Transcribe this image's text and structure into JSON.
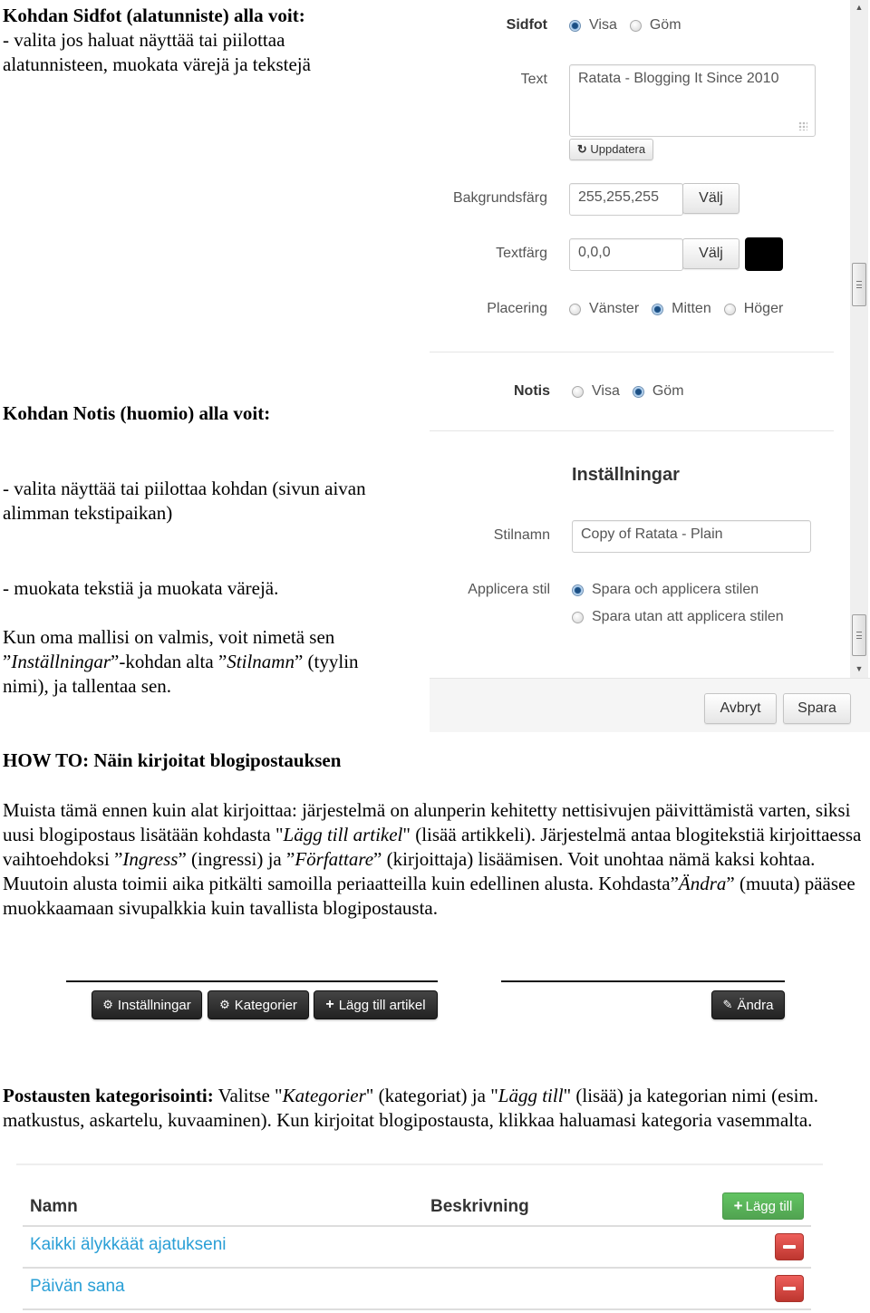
{
  "doc": {
    "sidfot_heading": "Kohdan Sidfot (alatunniste) alla voit:",
    "sidfot_line1": "- valita jos haluat näyttää tai piilottaa",
    "sidfot_line2": "alatunnisteen, muokata värejä ja tekstejä",
    "notis_heading": "Kohdan Notis (huomio) alla voit:",
    "notis_bullet1_line1": "- valita näyttää tai piilottaa kohdan (sivun aivan",
    "notis_bullet1_line2": "alimman tekstipaikan)",
    "notis_bullet2": "- muokata tekstiä ja muokata värejä.",
    "save_p_line1": "Kun oma mallisi on valmis, voit nimetä sen",
    "save_p_line2_q1": "”",
    "save_p_line2_em1": "Inställningar",
    "save_p_line2_mid": "”-kohdan alta ”",
    "save_p_line2_em2": "Stilnamn",
    "save_p_line2_end": "” (tyylin",
    "save_p_line3": "nimi), ja tallentaa sen.",
    "howto_heading": "HOW TO: Näin kirjoitat blogipostauksen",
    "howto_p": {
      "t1": "Muista tämä ennen kuin alat kirjoittaa: järjestelmä on alunperin kehitetty nettisivujen päivittämistä varten, siksi uusi blogipostaus lisätään kohdasta \"",
      "em1": "Lägg till artikel",
      "t2": "\" (lisää artikkeli). Järjestelmä antaa blogitekstiä kirjoittaessa vaihtoehdoksi ”",
      "em2": "Ingress",
      "t3": "” (ingressi) ja ”",
      "em3": "Författare",
      "t4": "” (kirjoittaja) lisäämisen. Voit unohtaa nämä kaksi kohtaa. Muutoin alusta toimii aika pitkälti samoilla periaatteilla kuin edellinen alusta. Kohdasta”",
      "em4": "Ändra",
      "t5": "” (muuta) pääsee muokkaamaan sivupalkkia kuin tavallista blogipostausta."
    },
    "cat_p": {
      "bold": "Postausten kategorisointi:",
      "t1": " Valitse \"",
      "em1": "Kategorier",
      "t2": "\" (kategoriat) ja \"",
      "em2": "Lägg till",
      "t3": "\" (lisää) ja kategorian nimi (esim. matkustus, askartelu, kuvaaminen). Kun kirjoitat blogipostausta, klikkaa haluamasi kategoria vasemmalta."
    }
  },
  "panel": {
    "sidfot": {
      "label": "Sidfot",
      "options": [
        "Visa",
        "Göm"
      ],
      "selected": "Visa"
    },
    "text": {
      "label": "Text",
      "value": "Ratata - Blogging It Since 2010",
      "update_button": "Uppdatera",
      "update_icon": "refresh-icon"
    },
    "bakgrundsfarg": {
      "label": "Bakgrundsfärg",
      "value": "255,255,255",
      "button": "Välj"
    },
    "textfarg": {
      "label": "Textfärg",
      "value": "0,0,0",
      "button": "Välj",
      "swatch_color": "#000000"
    },
    "placering": {
      "label": "Placering",
      "options": [
        "Vänster",
        "Mitten",
        "Höger"
      ],
      "selected": "Mitten"
    },
    "notis": {
      "label": "Notis",
      "options": [
        "Visa",
        "Göm"
      ],
      "selected": "Göm"
    },
    "installningar_heading": "Inställningar",
    "stilnamn": {
      "label": "Stilnamn",
      "value": "Copy of Ratata - Plain"
    },
    "applicera": {
      "label": "Applicera stil",
      "options": [
        "Spara och applicera stilen",
        "Spara utan att applicera stilen"
      ],
      "selected": "Spara och applicera stilen"
    },
    "footer": {
      "cancel": "Avbryt",
      "save": "Spara"
    }
  },
  "toolbar": {
    "buttons": [
      {
        "label": "Inställningar",
        "icon": "gear-icon"
      },
      {
        "label": "Kategorier",
        "icon": "gear-icon"
      },
      {
        "label": "Lägg till artikel",
        "icon": "plus-icon"
      }
    ],
    "edit_button": {
      "label": "Ändra",
      "icon": "pencil-icon"
    }
  },
  "categories": {
    "headers": {
      "name": "Namn",
      "description": "Beskrivning"
    },
    "add_button": "Lägg till",
    "rows": [
      {
        "name": "Kaikki älykkäät ajatukseni",
        "description": ""
      },
      {
        "name": "Päivän sana",
        "description": ""
      }
    ],
    "colors": {
      "link": "#2a9fd6",
      "add": "#5bb75b",
      "delete": "#da4f49"
    }
  }
}
